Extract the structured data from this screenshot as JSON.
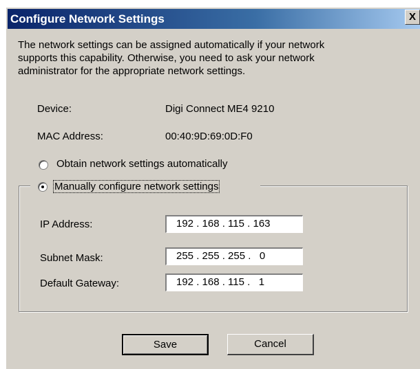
{
  "dialog": {
    "title": "Configure Network Settings",
    "close_glyph": "X",
    "intro_lines": [
      "The network settings can be assigned automatically if your network",
      "supports this capability. Otherwise, you need to ask your network",
      "administrator for the appropriate network settings."
    ],
    "device_label": "Device:",
    "device_value": "Digi Connect ME4 9210",
    "mac_label": "MAC Address:",
    "mac_value": "00:40:9D:69:0D:F0",
    "radio_auto_label": "Obtain network settings automatically",
    "radio_auto_selected": false,
    "radio_manual_label": "Manually configure network settings",
    "radio_manual_selected": true,
    "ip_label": "IP Address:",
    "ip_value": "192 . 168 . 115 . 163",
    "subnet_label": "Subnet Mask:",
    "subnet_value": "255 . 255 . 255 .   0",
    "gateway_label": "Default Gateway:",
    "gateway_value": "192 . 168 . 115 .   1",
    "save_label": "Save",
    "cancel_label": "Cancel"
  },
  "colors": {
    "titlebar": "#0a246a",
    "dialog_bg": "#d4d0c8"
  }
}
